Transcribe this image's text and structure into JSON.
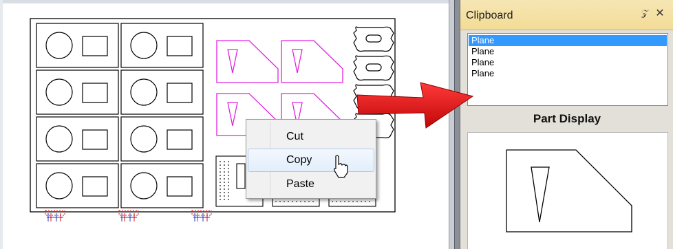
{
  "panel": {
    "title": "Clipboard",
    "pin_icon": "pin-icon",
    "close_icon": "close-icon",
    "list_items": [
      "Plane",
      "Plane",
      "Plane",
      "Plane"
    ],
    "selected_index": 0,
    "part_display_title": "Part Display"
  },
  "context_menu": {
    "items": [
      "Cut",
      "Copy",
      "Paste"
    ],
    "hovered_index": 1
  },
  "colors": {
    "highlight": "#3399ff",
    "selected_part": "#e020e0",
    "arrow": "#e01010",
    "panel_header": "#f3dc96",
    "marker_red": "#e01010",
    "marker_blue": "#2030c0"
  },
  "icons": [
    "pin-icon",
    "close-icon",
    "red-arrow-icon",
    "mouse-cursor-icon"
  ]
}
